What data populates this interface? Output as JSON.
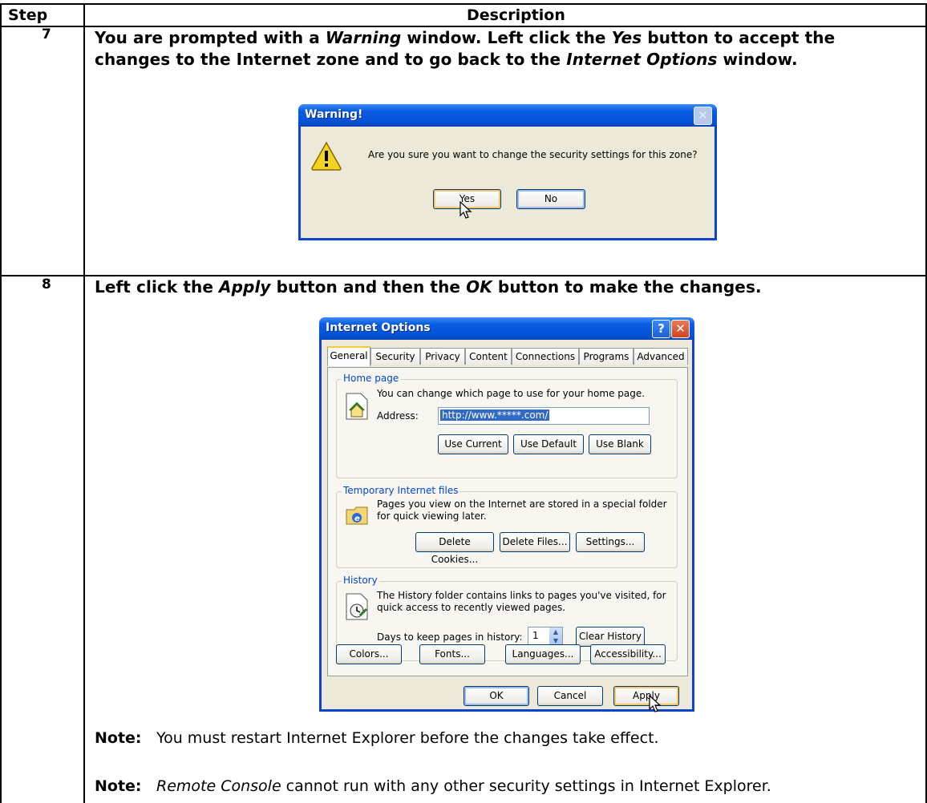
{
  "table": {
    "header_step": "Step",
    "header_description": "Description"
  },
  "step7": {
    "number": "7",
    "line1_a": "You are prompted with a ",
    "line1_i1": "Warning",
    "line1_b": " window. Left click the ",
    "line1_i2": "Yes",
    "line1_c": " button to accept the",
    "line2_a": "changes to the Internet zone and to go back to the ",
    "line2_i": "Internet Options",
    "line2_b": " window."
  },
  "warning_dialog": {
    "title": "Warning!",
    "message": "Are you sure you want to change the security settings for this zone?",
    "yes_label": "Yes",
    "no_label": "No"
  },
  "step8": {
    "number": "8",
    "text_a": "Left click the ",
    "text_i1": "Apply",
    "text_b": " button and then the ",
    "text_i2": "OK",
    "text_c": " button to make the changes."
  },
  "internet_options": {
    "title": "Internet Options",
    "tabs": [
      "General",
      "Security",
      "Privacy",
      "Content",
      "Connections",
      "Programs",
      "Advanced"
    ],
    "home_page": {
      "group_title": "Home page",
      "text": "You can change which page to use for your home page.",
      "address_label": "Address:",
      "address_value": "http://www.*****.com/",
      "use_current": "Use Current",
      "use_default": "Use Default",
      "use_blank": "Use Blank"
    },
    "temp_files": {
      "group_title": "Temporary Internet files",
      "text_line1": "Pages you view on the Internet are stored in a special folder",
      "text_line2": "for quick viewing later.",
      "delete_cookies": "Delete Cookies...",
      "delete_files": "Delete Files...",
      "settings": "Settings..."
    },
    "history": {
      "group_title": "History",
      "text_line1": "The History folder contains links to pages you've visited, for",
      "text_line2": "quick access to recently viewed pages.",
      "days_label": "Days to keep pages in history:",
      "days_value": "1",
      "clear_history": "Clear History"
    },
    "bottom_buttons": {
      "colors": "Colors...",
      "fonts": "Fonts...",
      "languages": "Languages...",
      "accessibility": "Accessibility..."
    },
    "ok": "OK",
    "cancel": "Cancel",
    "apply": "Apply"
  },
  "notes": [
    {
      "label": "Note:",
      "text": "You must restart Internet Explorer before the changes take effect."
    },
    {
      "label": "Note:",
      "italic": "Remote Console",
      "text": " cannot run with any other security settings in Internet Explorer."
    }
  ],
  "icons": {
    "warning": "warning-icon",
    "home": "home-page-icon",
    "temp_files": "temp-files-icon",
    "history": "history-icon",
    "cursor": "mouse-cursor-icon"
  },
  "colors": {
    "xp_title_blue": "#0452d6",
    "dialog_face": "#ece9d8",
    "close_red": "#d2441c",
    "focus_orange": "#f5c56a"
  }
}
